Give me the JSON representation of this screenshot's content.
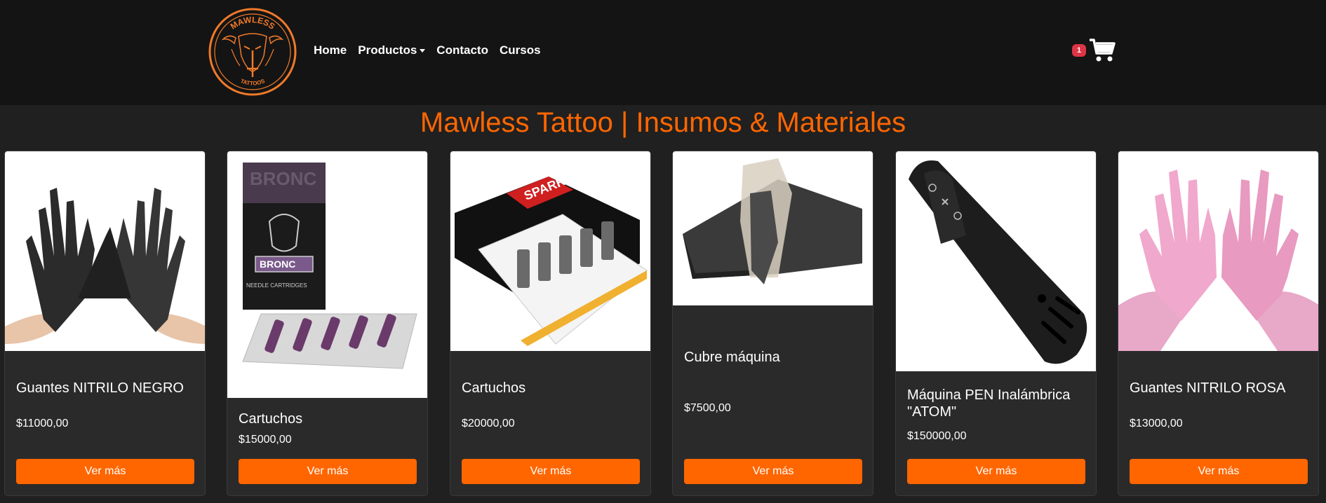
{
  "colors": {
    "accent": "#ff6600",
    "navbar_bg": "#141414",
    "page_bg": "#202020",
    "badge": "#dc3545"
  },
  "brand": {
    "logo_top_text": "MAWLESS",
    "logo_bottom_text": "TATTOOS"
  },
  "nav": {
    "home": "Home",
    "productos": "Productos",
    "contacto": "Contacto",
    "cursos": "Cursos"
  },
  "cart": {
    "count": "1",
    "icon": "cart-icon"
  },
  "title": "Mawless Tattoo | Insumos & Materiales",
  "products": [
    {
      "name": "Guantes NITRILO NEGRO",
      "price": "$11000,00",
      "button": "Ver más"
    },
    {
      "name": "Cartuchos",
      "price": "$15000,00",
      "button": "Ver más",
      "package_text": "NEEDLE CARTRIDGES",
      "brand_text": "BRONC"
    },
    {
      "name": "Cartuchos",
      "price": "$20000,00",
      "button": "Ver más",
      "package_text": "SPARK"
    },
    {
      "name": "Cubre máquina",
      "price": "$7500,00",
      "button": "Ver más"
    },
    {
      "name": "Máquina PEN Inalámbrica \"ATOM\"",
      "price": "$150000,00",
      "button": "Ver más"
    },
    {
      "name": "Guantes NITRILO ROSA",
      "price": "$13000,00",
      "button": "Ver más"
    }
  ]
}
